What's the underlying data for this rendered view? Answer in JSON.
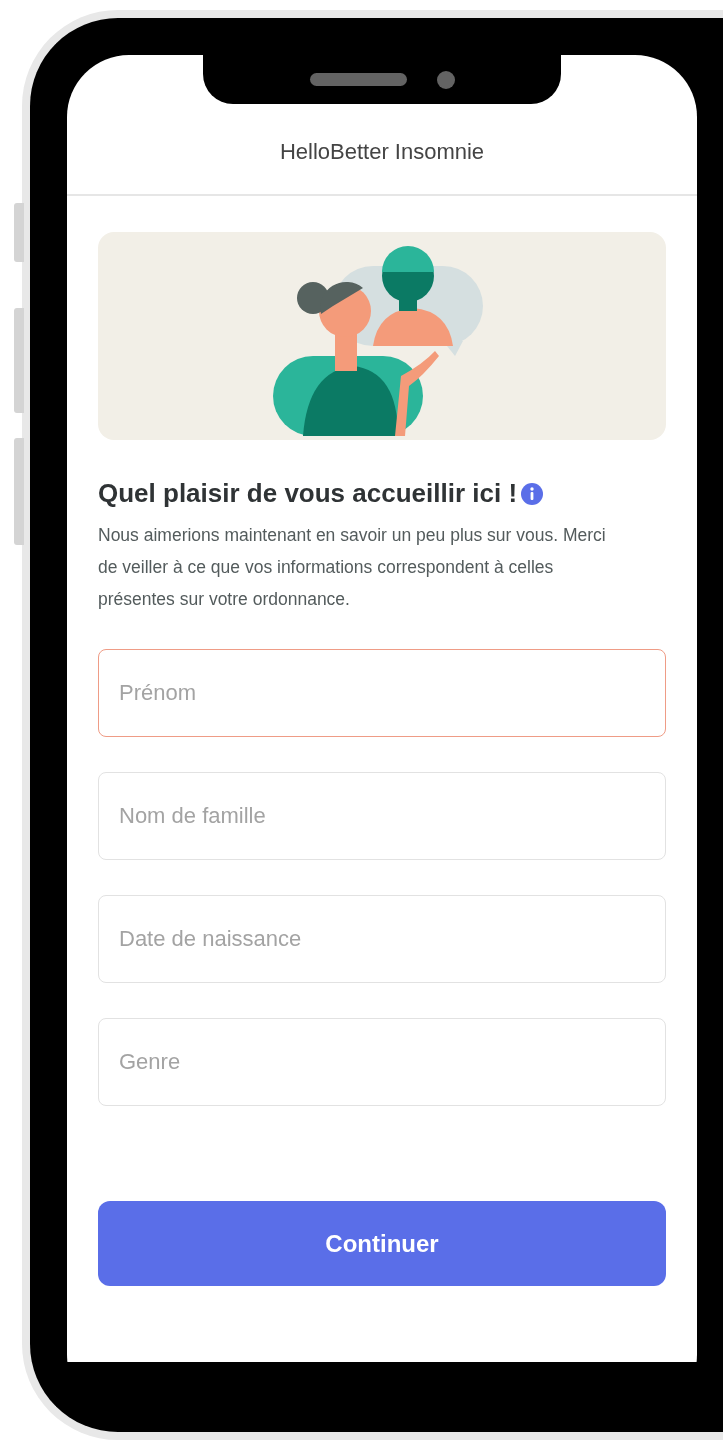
{
  "app_bar": {
    "title": "HelloBetter Insomnie"
  },
  "heading": "Quel plaisir de vous accueillir ici !",
  "intro": "Nous aimerions maintenant en savoir un peu plus sur vous. Merci de veiller à ce que vos informations correspondent à celles présentes sur votre ordonnance.",
  "fields": [
    {
      "placeholder": "Prénom",
      "invalid": true
    },
    {
      "placeholder": "Nom de famille",
      "invalid": false
    },
    {
      "placeholder": "Date de naissance",
      "invalid": false
    },
    {
      "placeholder": "Genre",
      "invalid": false
    }
  ],
  "primary_button": "Continuer"
}
